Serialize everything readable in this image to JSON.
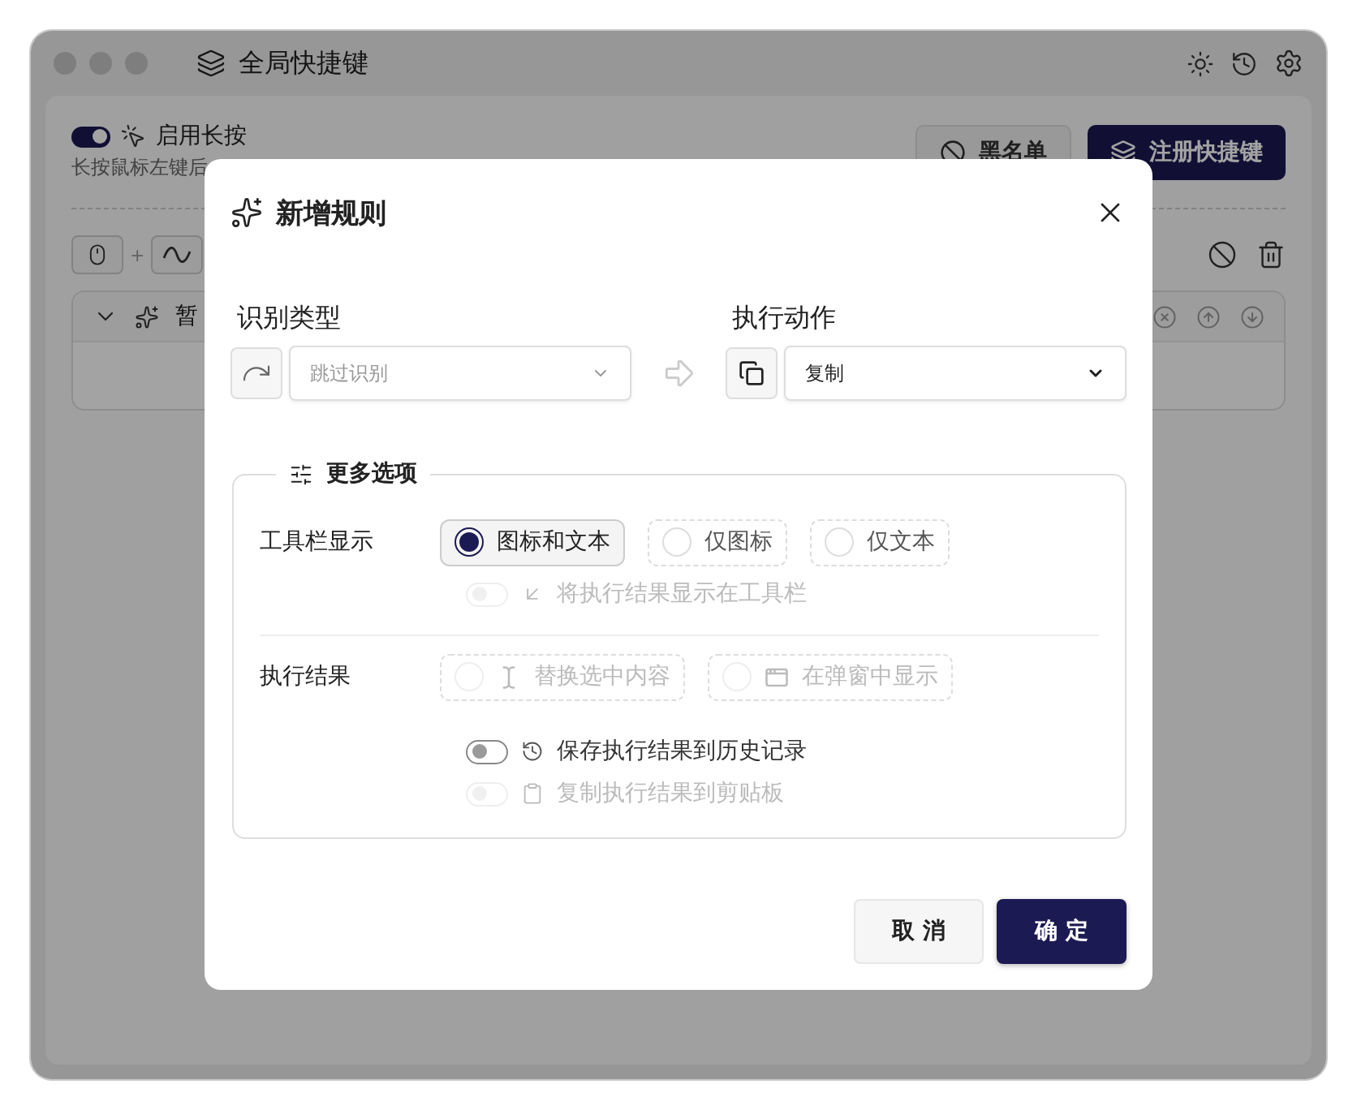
{
  "window": {
    "title": "全局快捷键"
  },
  "long_press": {
    "label": "启用长按",
    "on": true,
    "description": "长按鼠标左键后"
  },
  "toolbar_buttons": [
    {
      "label": "黑名单",
      "kind": "secondary"
    },
    {
      "label": "注册快捷键",
      "kind": "primary"
    }
  ],
  "shortcut_keys": {
    "separator": "+"
  },
  "rule_card": {
    "expanded": true,
    "title": "暂"
  },
  "dialog": {
    "title": "新增规则",
    "recognize": {
      "label": "识别类型",
      "placeholder": "跳过识别"
    },
    "action": {
      "label": "执行动作",
      "value": "复制"
    },
    "more_options": {
      "title": "更多选项",
      "toolbar_display": {
        "label": "工具栏显示",
        "options": [
          {
            "label": "图标和文本",
            "selected": true,
            "disabled": false
          },
          {
            "label": "仅图标",
            "selected": false,
            "disabled": false
          },
          {
            "label": "仅文本",
            "selected": false,
            "disabled": false
          }
        ]
      },
      "show_in_toolbar": {
        "label": "将执行结果显示在工具栏",
        "on": false,
        "disabled": true
      },
      "result": {
        "label": "执行结果",
        "options": [
          {
            "label": "替换选中内容",
            "selected": false,
            "disabled": true
          },
          {
            "label": "在弹窗中显示",
            "selected": false,
            "disabled": true
          }
        ]
      },
      "toggles": [
        {
          "label": "保存执行结果到历史记录",
          "on": false,
          "disabled": false
        },
        {
          "label": "复制执行结果到剪贴板",
          "on": false,
          "disabled": true
        }
      ]
    },
    "buttons": [
      {
        "label": "取 消",
        "kind": "secondary"
      },
      {
        "label": "确 定",
        "kind": "primary"
      }
    ]
  }
}
